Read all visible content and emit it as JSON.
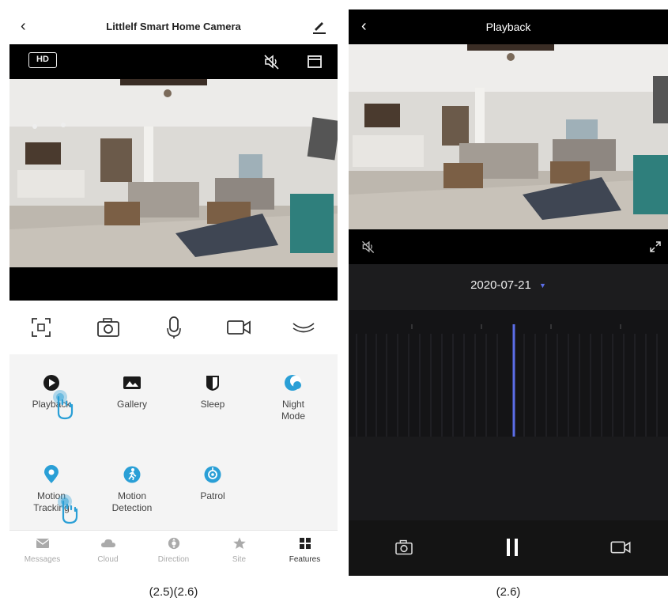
{
  "left_screen": {
    "header": {
      "title": "Littlelf Smart Home Camera"
    },
    "video_bar": {
      "quality_label": "HD"
    },
    "features": [
      {
        "label": "Playback",
        "icon": "play-circle-icon",
        "color": "#1a1a1a"
      },
      {
        "label": "Gallery",
        "icon": "gallery-icon",
        "color": "#1a1a1a"
      },
      {
        "label": "Sleep",
        "icon": "sleep-shield-icon",
        "color": "#1a1a1a"
      },
      {
        "label": "Night\nMode",
        "icon": "night-mode-icon",
        "color": "#2a9fd6"
      },
      {
        "label": "Motion\nTracking",
        "icon": "location-pin-icon",
        "color": "#2a9fd6"
      },
      {
        "label": "Motion\nDetection",
        "icon": "running-person-icon",
        "color": "#2a9fd6"
      },
      {
        "label": "Patrol",
        "icon": "patrol-icon",
        "color": "#2a9fd6"
      }
    ],
    "tabs": [
      {
        "label": "Messages",
        "icon": "messages-icon",
        "active": false
      },
      {
        "label": "Cloud",
        "icon": "cloud-icon",
        "active": false
      },
      {
        "label": "Direction",
        "icon": "direction-icon",
        "active": false
      },
      {
        "label": "Site",
        "icon": "star-icon",
        "active": false
      },
      {
        "label": "Features",
        "icon": "grid-icon",
        "active": true
      }
    ],
    "caption": "(2.5)(2.6)"
  },
  "right_screen": {
    "header": {
      "title": "Playback"
    },
    "date": "2020-07-21",
    "date_arrow": "▼",
    "caption": "(2.6)"
  },
  "colors": {
    "accent": "#2a9fd6",
    "timeline_marker": "#5b6ee8"
  }
}
